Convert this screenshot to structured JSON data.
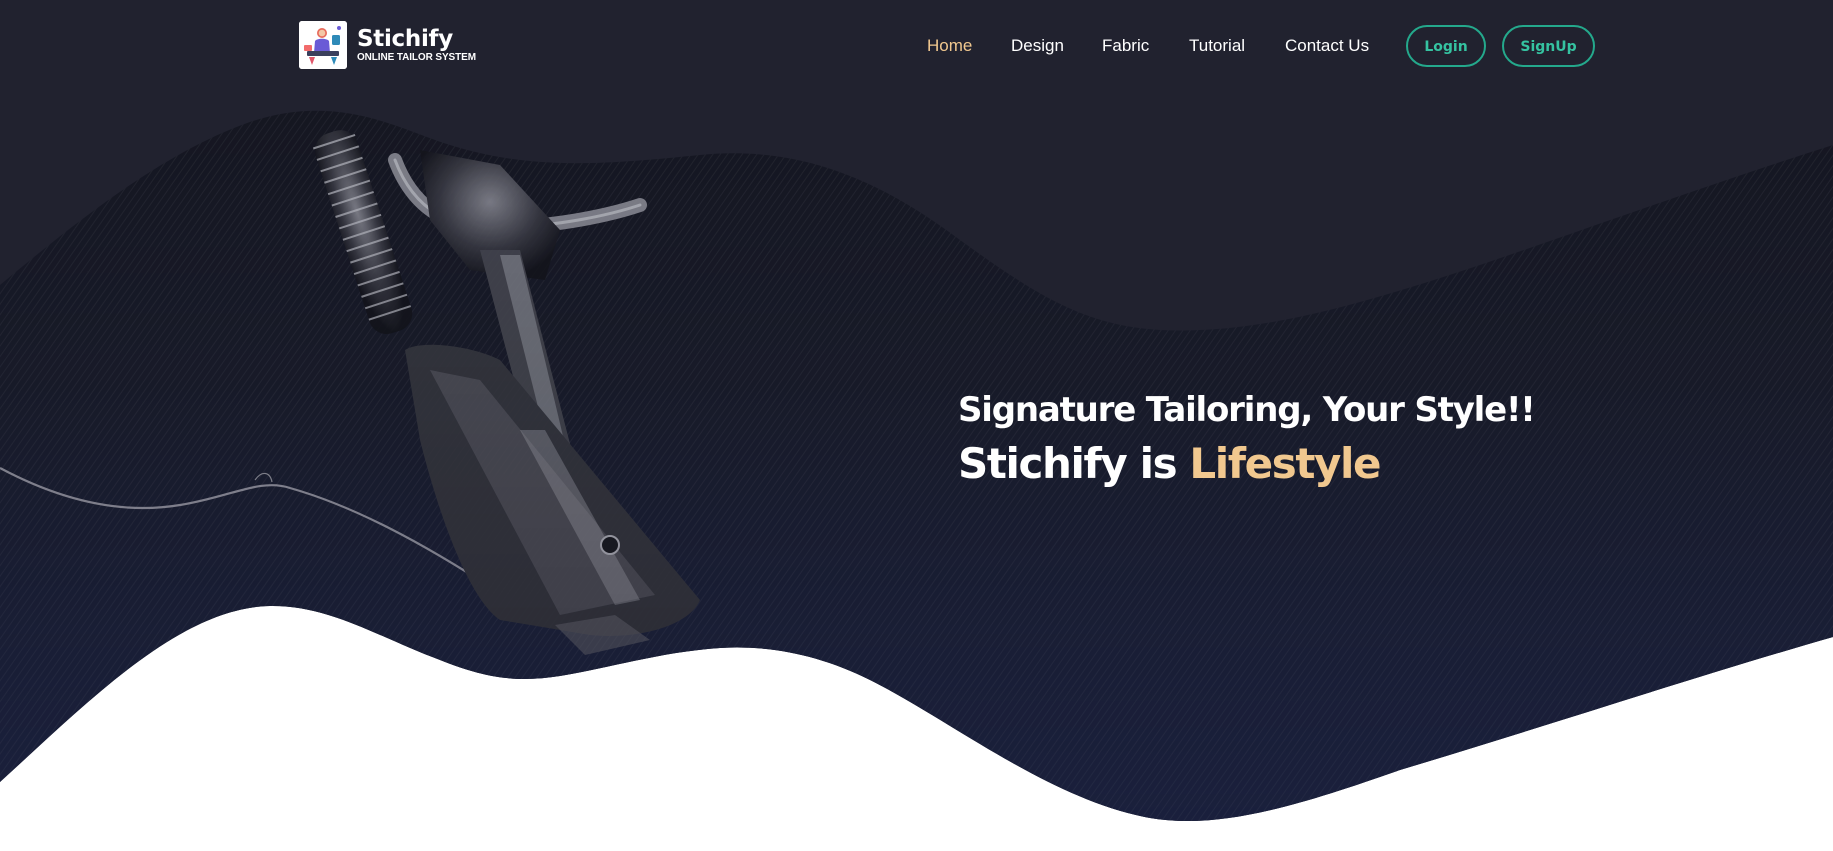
{
  "brand": {
    "name": "Stichify",
    "tagline": "ONLINE TAILOR SYSTEM",
    "logo_icon": "tailor-illustration-icon"
  },
  "nav": {
    "items": [
      {
        "label": "Home",
        "active": true
      },
      {
        "label": "Design",
        "active": false
      },
      {
        "label": "Fabric",
        "active": false
      },
      {
        "label": "Tutorial",
        "active": false
      },
      {
        "label": "Contact Us",
        "active": false
      }
    ],
    "login_label": "Login",
    "signup_label": "SignUp"
  },
  "hero": {
    "tagline": "Signature Tailoring, Your Style!!",
    "headline_prefix": "Stichify is",
    "headline_accent": "Lifestyle",
    "image_subject": "sewing-machine-presser-foot"
  },
  "colors": {
    "background_dark": "#21222f",
    "wave_top": "#171822",
    "wave_bottom": "#222a4f",
    "accent_gold": "#f1c88f",
    "accent_teal": "#24a98c",
    "text_light": "#ffffff"
  }
}
